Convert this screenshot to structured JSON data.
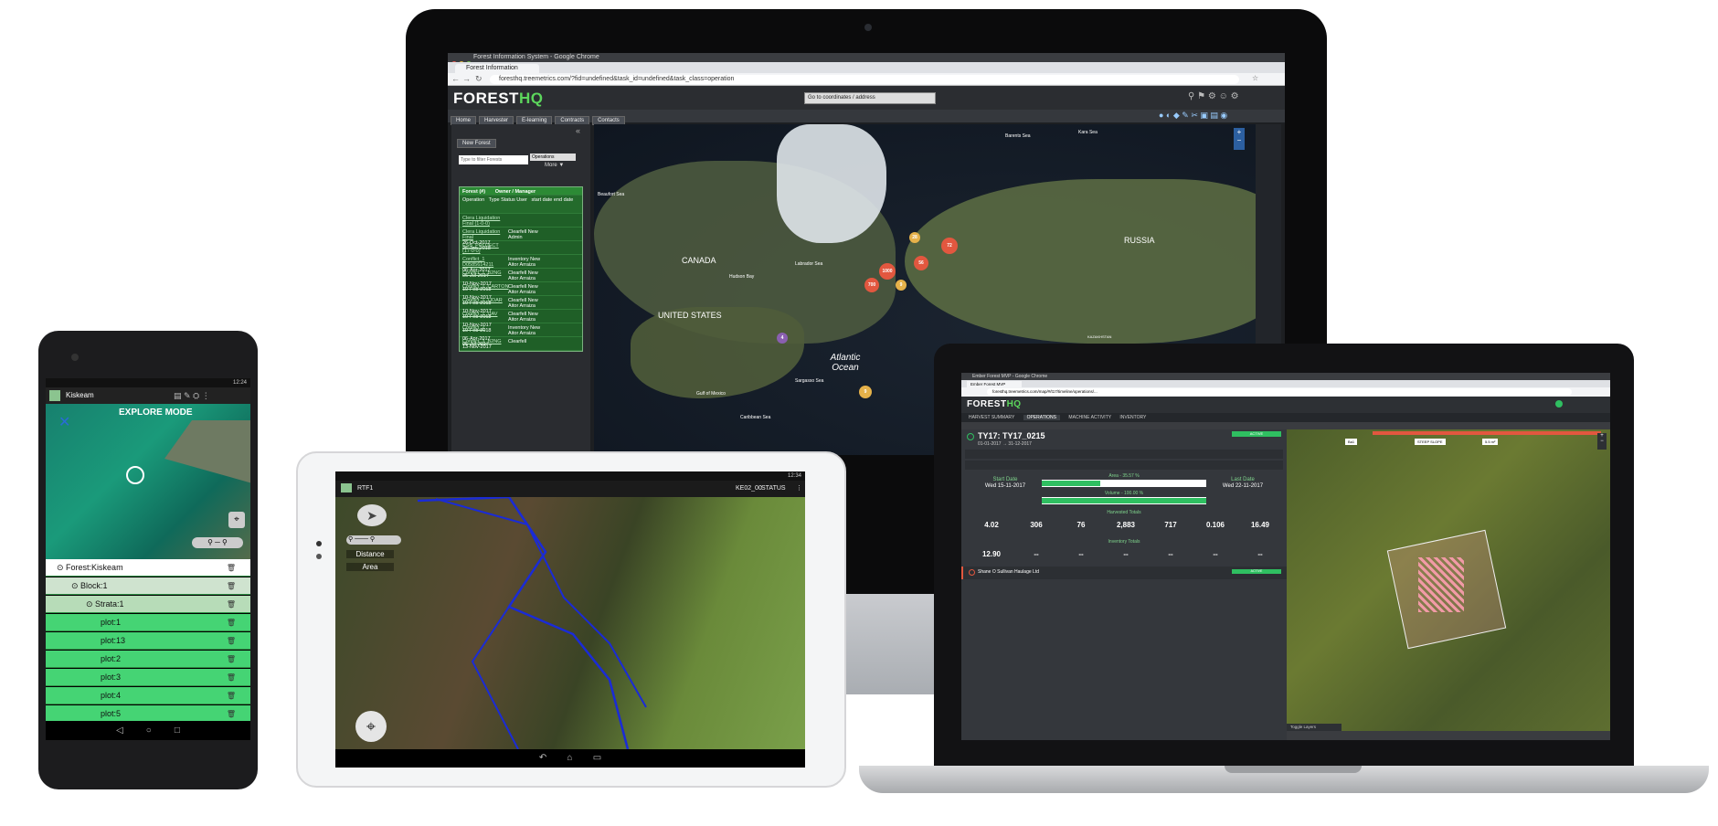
{
  "monitor": {
    "window_title": "Forest Information System - Google Chrome",
    "tab_label": "Forest Information",
    "url": "foresthq.treemetrics.com/?fid=undefined&task_id=undefined&task_class=operation",
    "logo_main": "FOREST",
    "logo_accent": "HQ",
    "coords_placeholder": "Go to coordinates / address",
    "nav": [
      "Home",
      "Harvester",
      "E-learning",
      "Contracts",
      "Contacts"
    ],
    "new_forest": "New Forest",
    "filter_placeholder": "Type to filter Forests",
    "filter_select": "Operations",
    "more": "More ▼",
    "table_header": [
      "Forest (#)",
      "Owner / Manager"
    ],
    "table_subheader": [
      "Operation",
      "Type Status User",
      "start date end date"
    ],
    "rows": [
      {
        "name": "Clera Liquidation Final (1-0-0)",
        "type": "",
        "date": ""
      },
      {
        "name": "Clera Liquidation Final",
        "type": "Clearfell New Admin",
        "date": "26-Oct-2017 26-Jan-2018"
      },
      {
        "name": "ESB_PROJECT (17-0-0)",
        "type": "",
        "date": ""
      },
      {
        "name": "Conflict_1 D0585614211",
        "type": "Inventory New Aitor Arraiza",
        "date": "06-Apr-2017 06-Jul-2017"
      },
      {
        "name": "Conflict_1_B2NG",
        "type": "Clearfell New Aitor Arraiza",
        "date": "10-Nov-2017 10-Feb-2018"
      },
      {
        "name": "Conflict_1_CARTON",
        "type": "Clearfell New Aitor Arraiza",
        "date": "10-Nov-2017 10-Feb-2018"
      },
      {
        "name": "Conflict_1_LIDAR",
        "type": "Clearfell New Aitor Arraiza",
        "date": "10-Nov-2017 10-Feb-2018"
      },
      {
        "name": "Conflict_1_UAV",
        "type": "Clearfell New Aitor Arraiza",
        "date": "10-Nov-2017 10-Feb-2018"
      },
      {
        "name": "Conflict_2",
        "type": "Inventory New Aitor Arraiza",
        "date": "06-Apr-2017 06-Jul-2017"
      },
      {
        "name": "Conflict_3_B2NG",
        "type": "Clearfell",
        "date": "13-Nov-2017"
      }
    ],
    "map_labels": [
      "CANADA",
      "UNITED STATES",
      "RUSSIA",
      "Atlantic Ocean",
      "Barents Sea",
      "Kara Sea",
      "Labrador Sea",
      "Hudson Bay",
      "Sargasso Sea",
      "Caribbean Sea",
      "Gulf of Mexico",
      "Beaufort Sea",
      "KAZAKHSTAN"
    ],
    "clusters": [
      "72",
      "56",
      "28",
      "1000",
      "700",
      "9",
      "4",
      "9"
    ]
  },
  "phone": {
    "status_time": "12:24",
    "app_title": "Kiskeam",
    "mode_label": "EXPLORE MODE",
    "tree": [
      {
        "label": "Forest:Kiskeam",
        "level": 0
      },
      {
        "label": "Block:1",
        "level": 1
      },
      {
        "label": "Strata:1",
        "level": 2
      },
      {
        "label": "plot:1",
        "level": 3
      },
      {
        "label": "plot:13",
        "level": 3
      },
      {
        "label": "plot:2",
        "level": 3
      },
      {
        "label": "plot:3",
        "level": 3
      },
      {
        "label": "plot:4",
        "level": 3
      },
      {
        "label": "plot:5",
        "level": 3
      }
    ],
    "nav": [
      "◁",
      "○",
      "□"
    ]
  },
  "tablet": {
    "status_time": "12:34",
    "app_title": "RTF1",
    "right_labels": [
      "KE02_00",
      "STATUS"
    ],
    "overlay_labels": [
      "Distance",
      "Area"
    ],
    "nav": [
      "↶",
      "⌂",
      "▭"
    ]
  },
  "laptop": {
    "window_title": "Ember Forest MVP - Google Chrome",
    "tab_label": "Ember Forest MVP",
    "url": "foresthq.treemetrics.com/map/#/t17/timeline/operations/...",
    "logo_main": "FOREST",
    "logo_accent": "HQ",
    "menu": [
      "HARVEST SUMMARY",
      "OPERATIONS",
      "MACHINE ACTIVITY",
      "INVENTORY"
    ],
    "op_title": "TY17: TY17_0215",
    "op_dates": "01-01-2017 → 31-12-2017",
    "status_badge": "ACTIVE",
    "start_label": "Start Date",
    "start_date": "Wed 15-11-2017",
    "end_label": "Last Date",
    "end_date": "Wed 22-11-2017",
    "area_label": "Area - 35.57 %",
    "volume_label": "Volume - 100.00 %",
    "harvest_totals": "Harvested Totals",
    "harvest_stats": [
      "4.02",
      "306",
      "76",
      "2,883",
      "717",
      "0.106",
      "16.49"
    ],
    "inventory_totals": "Inventory Totals",
    "inventory_stats": [
      "12.90",
      "--",
      "--",
      "--",
      "--",
      "--",
      "--"
    ],
    "contractor": "Shane O Sullivan Haulage Ltd",
    "contractor_badge": "ACTIVE",
    "toggle_layers": "Toggle Layers",
    "map_tags": [
      "Ba1",
      "STEEP SLOPE",
      "5.5 m²"
    ]
  }
}
